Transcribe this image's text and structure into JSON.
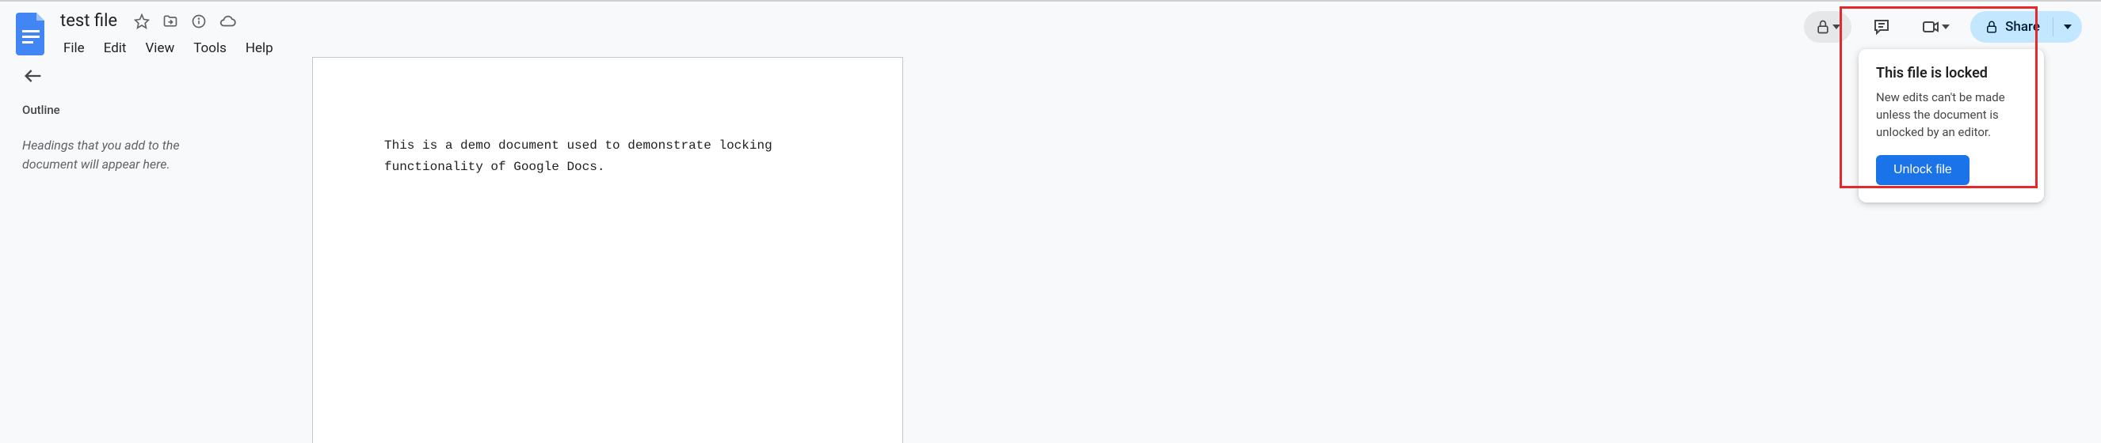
{
  "header": {
    "title": "test file",
    "menu": {
      "file": "File",
      "edit": "Edit",
      "view": "View",
      "tools": "Tools",
      "help": "Help"
    },
    "share_label": "Share"
  },
  "sidebar": {
    "outline_label": "Outline",
    "placeholder": "Headings that you add to the document will appear here."
  },
  "document": {
    "body": "This is a demo document used to demonstrate locking functionality of Google Docs."
  },
  "popover": {
    "title": "This file is locked",
    "body": "New edits can't be made unless the document is unlocked by an editor.",
    "button": "Unlock file"
  }
}
